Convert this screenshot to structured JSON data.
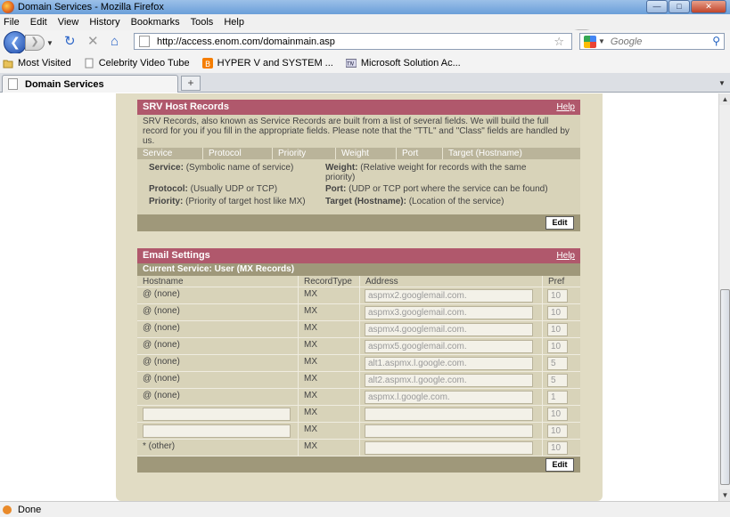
{
  "window": {
    "title": "Domain Services - Mozilla Firefox"
  },
  "menu": [
    "File",
    "Edit",
    "View",
    "History",
    "Bookmarks",
    "Tools",
    "Help"
  ],
  "nav": {
    "url": "http://access.enom.com/domainmain.asp",
    "search_placeholder": "Google"
  },
  "bookmarks": [
    "Most Visited",
    "Celebrity Video Tube",
    "HYPER V and SYSTEM ...",
    "Microsoft Solution Ac..."
  ],
  "tabs": [
    {
      "label": "Domain Services"
    }
  ],
  "srv": {
    "title": "SRV Host Records",
    "help": "Help",
    "description": "SRV Records, also known as Service Records are built from a list of several fields. We will build the full record for you if you fill in the appropriate fields. Please note that the \"TTL\" and \"Class\" fields are handled by us.",
    "columns": [
      "Service",
      "Protocol",
      "Priority",
      "Weight",
      "Port",
      "Target (Hostname)"
    ],
    "defs": {
      "service_label": "Service:",
      "service_text": "(Symbolic name of service)",
      "weight_label": "Weight:",
      "weight_text": "(Relative weight for records with the same priority)",
      "protocol_label": "Protocol:",
      "protocol_text": "(Usually UDP or TCP)",
      "port_label": "Port:",
      "port_text": "(UDP or TCP port where the service can be found)",
      "priority_label": "Priority:",
      "priority_text": "(Priority of target host like MX)",
      "target_label": "Target (Hostname):",
      "target_text": "(Location of the service)"
    },
    "edit": "Edit"
  },
  "email": {
    "title": "Email Settings",
    "help": "Help",
    "current_service": "Current Service: User (MX Records)",
    "columns": {
      "hostname": "Hostname",
      "recordtype": "RecordType",
      "address": "Address",
      "pref": "Pref"
    },
    "rows": [
      {
        "host": "@ (none)",
        "type": "MX",
        "address": "aspmx2.googlemail.com.",
        "pref": "10"
      },
      {
        "host": "@ (none)",
        "type": "MX",
        "address": "aspmx3.googlemail.com.",
        "pref": "10"
      },
      {
        "host": "@ (none)",
        "type": "MX",
        "address": "aspmx4.googlemail.com.",
        "pref": "10"
      },
      {
        "host": "@ (none)",
        "type": "MX",
        "address": "aspmx5.googlemail.com.",
        "pref": "10"
      },
      {
        "host": "@ (none)",
        "type": "MX",
        "address": "alt1.aspmx.l.google.com.",
        "pref": "5"
      },
      {
        "host": "@ (none)",
        "type": "MX",
        "address": "alt2.aspmx.l.google.com.",
        "pref": "5"
      },
      {
        "host": "@ (none)",
        "type": "MX",
        "address": "aspmx.l.google.com.",
        "pref": "1"
      },
      {
        "host": "",
        "type": "MX",
        "address": "",
        "pref": "10"
      },
      {
        "host": "",
        "type": "MX",
        "address": "",
        "pref": "10"
      },
      {
        "host": "* (other)",
        "type": "MX",
        "address": "",
        "pref": "10"
      }
    ],
    "edit": "Edit"
  },
  "status": {
    "text": "Done"
  }
}
